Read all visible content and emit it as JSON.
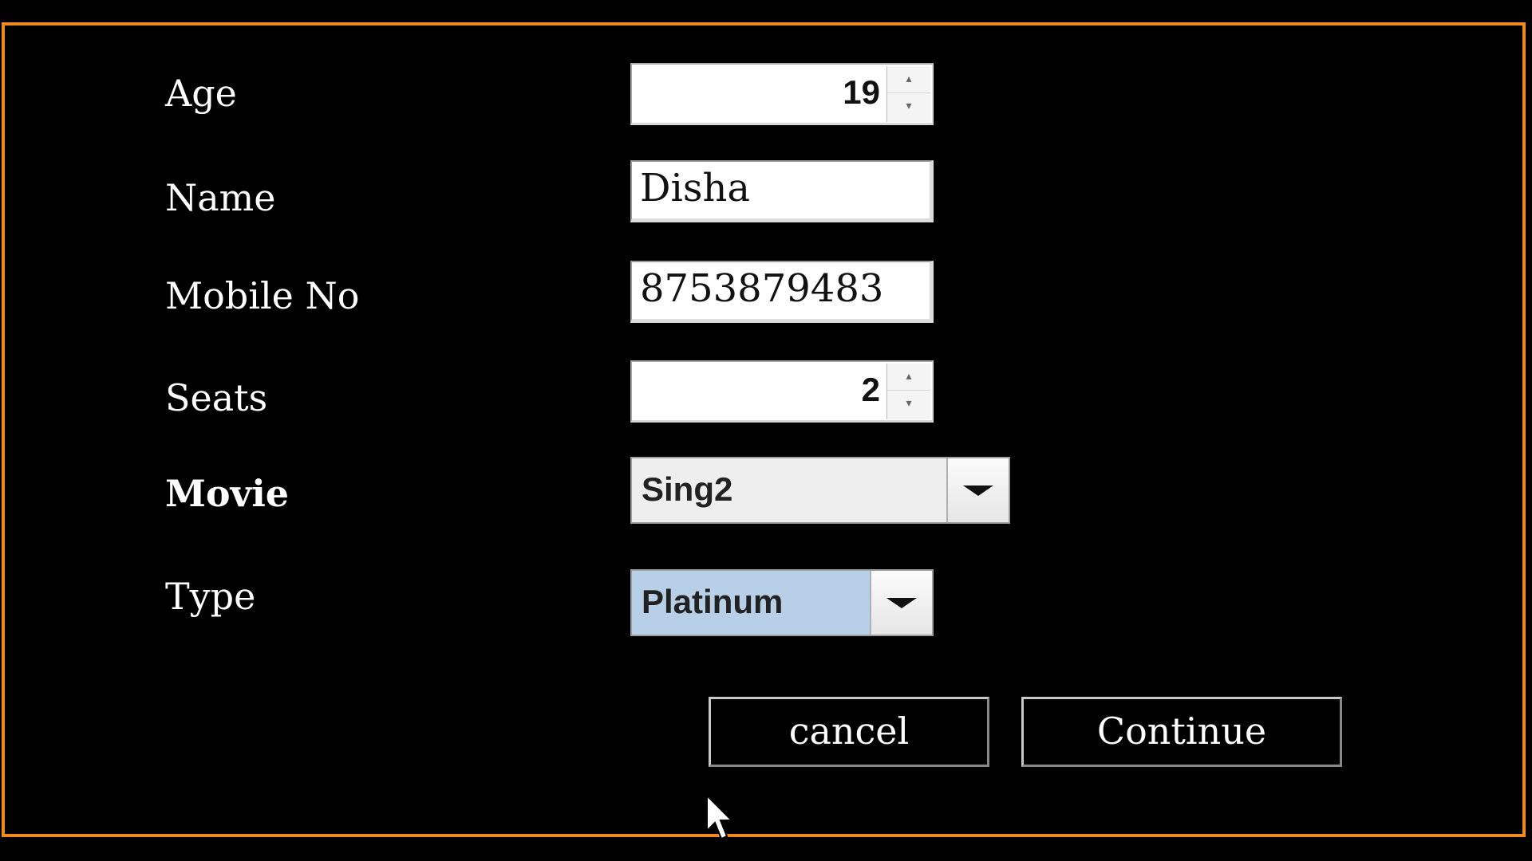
{
  "form": {
    "age": {
      "label": "Age",
      "value": "19"
    },
    "name": {
      "label": "Name",
      "value": "Disha"
    },
    "mobile": {
      "label": "Mobile No",
      "value": "8753879483"
    },
    "seats": {
      "label": "Seats",
      "value": "2"
    },
    "movie": {
      "label": "Movie",
      "selected": "Sing2"
    },
    "type": {
      "label": "Type",
      "selected": "Platinum"
    }
  },
  "buttons": {
    "cancel_label": "cancel",
    "continue_label": "Continue"
  },
  "colors": {
    "background": "#000000",
    "frame_border": "#f08a1e",
    "movie_combo_bg": "#eeeeee",
    "type_combo_bg": "#b8cfe8"
  },
  "icons": {
    "spinner_up": "triangle-up-icon",
    "spinner_down": "triangle-down-icon",
    "dropdown": "chevron-down-icon",
    "cursor": "mouse-pointer-icon"
  }
}
